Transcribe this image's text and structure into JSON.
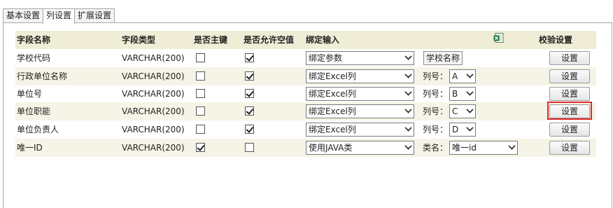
{
  "tabs": [
    {
      "label": "基本设置",
      "active": false
    },
    {
      "label": "列设置",
      "active": true
    },
    {
      "label": "扩展设置",
      "active": false
    }
  ],
  "table": {
    "headers": {
      "field_name": "字段名称",
      "field_type": "字段类型",
      "is_pk": "是否主键",
      "allow_null": "是否允许空值",
      "binding": "绑定输入",
      "validate": "校验设置"
    },
    "excel_icon": "excel-import-icon",
    "rows": [
      {
        "name": "学校代码",
        "type": "VARCHAR(200)",
        "pk": false,
        "nullable": true,
        "bind": "绑定参数",
        "param_label": "",
        "param_value": "学校名称",
        "button": "设置"
      },
      {
        "name": "行政单位名称",
        "type": "VARCHAR(200)",
        "pk": false,
        "nullable": true,
        "bind": "绑定Excel列",
        "param_label": "列号：",
        "param_value": "A",
        "button": "设置"
      },
      {
        "name": "单位号",
        "type": "VARCHAR(200)",
        "pk": false,
        "nullable": true,
        "bind": "绑定Excel列",
        "param_label": "列号：",
        "param_value": "B",
        "button": "设置"
      },
      {
        "name": "单位职能",
        "type": "VARCHAR(200)",
        "pk": false,
        "nullable": true,
        "bind": "绑定Excel列",
        "param_label": "列号：",
        "param_value": "C",
        "button": "设置"
      },
      {
        "name": "单位负责人",
        "type": "VARCHAR(200)",
        "pk": false,
        "nullable": true,
        "bind": "绑定Excel列",
        "param_label": "列号：",
        "param_value": "D",
        "button": "设置"
      },
      {
        "name": "唯一ID",
        "type": "VARCHAR(200)",
        "pk": true,
        "nullable": false,
        "bind": "使用JAVA类",
        "param_label": "类名：",
        "param_value": "唯一id",
        "button": "设置"
      }
    ]
  },
  "colors": {
    "header_bg": "#efedd6",
    "alt_row_bg": "#f5f4e6",
    "highlight": "#e02a2a"
  }
}
